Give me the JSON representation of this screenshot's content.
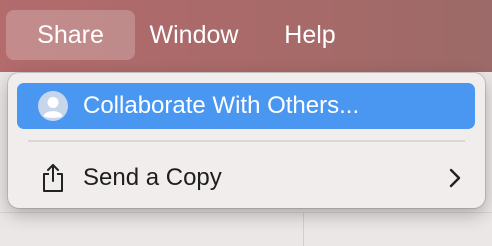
{
  "menubar": {
    "items": [
      {
        "label": "Share",
        "active": true
      },
      {
        "label": "Window",
        "active": false
      },
      {
        "label": "Help",
        "active": false
      }
    ],
    "background_color": "#a86a69"
  },
  "share_menu": {
    "items": [
      {
        "label": "Collaborate With Others...",
        "icon": "person-icon",
        "highlighted": true
      },
      {
        "label": "Send a Copy",
        "icon": "share-icon",
        "has_submenu": true
      }
    ],
    "highlight_color": "#4a97f2"
  }
}
